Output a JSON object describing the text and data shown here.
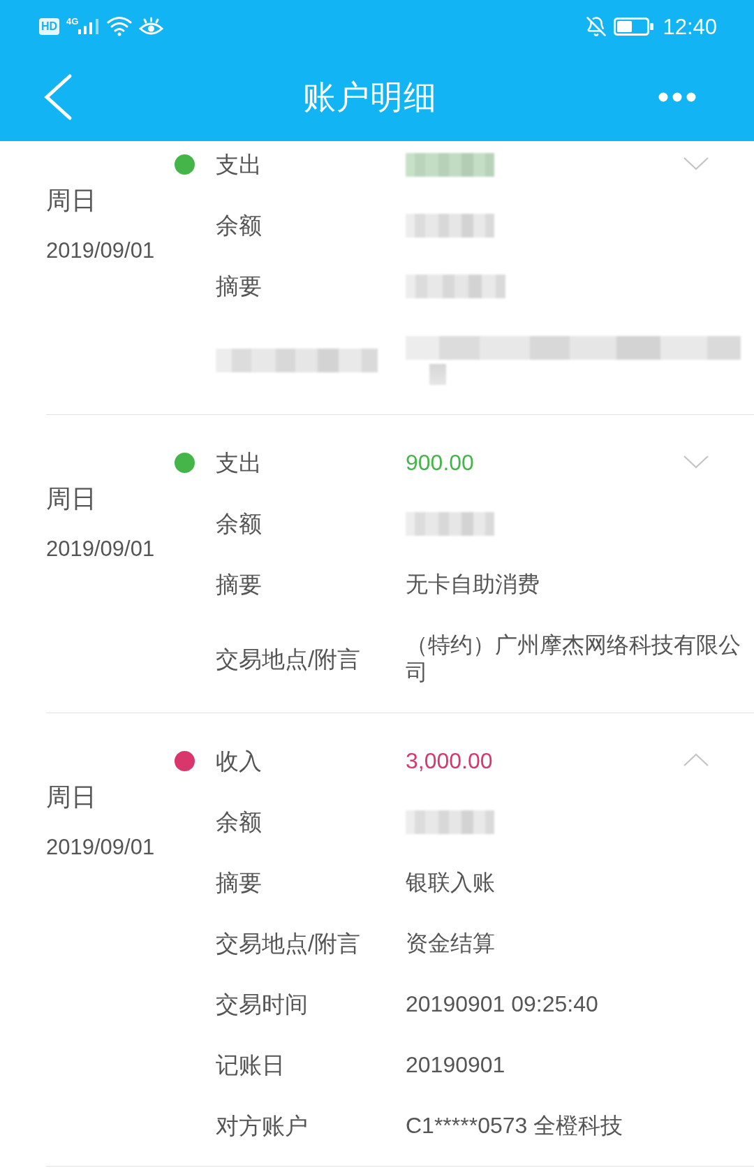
{
  "status_bar": {
    "hd_badge": "HD",
    "network": "4G",
    "time": "12:40"
  },
  "header": {
    "title": "账户明细"
  },
  "entries": [
    {
      "weekday": "周日",
      "date": "2019/09/01",
      "type": "支出",
      "color": "#45b549",
      "expanded": false,
      "amount_redacted": true,
      "fields": [
        {
          "label": "余额",
          "label_redacted": false,
          "value_redacted": true
        },
        {
          "label": "摘要",
          "label_redacted": false,
          "value_redacted": true
        },
        {
          "label_redacted": true,
          "value_redacted": true
        }
      ]
    },
    {
      "weekday": "周日",
      "date": "2019/09/01",
      "type": "支出",
      "color": "#45b549",
      "expanded": false,
      "amount": "900.00",
      "amount_redacted": false,
      "fields": [
        {
          "label": "余额",
          "label_redacted": false,
          "value_redacted": true
        },
        {
          "label": "摘要",
          "label_redacted": false,
          "value": "无卡自助消费",
          "value_redacted": false
        },
        {
          "label": "交易地点/附言",
          "label_redacted": false,
          "value": "（特约）广州摩杰网络科技有限公司",
          "value_redacted": false
        }
      ]
    },
    {
      "weekday": "周日",
      "date": "2019/09/01",
      "type": "收入",
      "color": "#d9376b",
      "expanded": true,
      "amount": "3,000.00",
      "amount_redacted": false,
      "fields": [
        {
          "label": "余额",
          "label_redacted": false,
          "value_redacted": true
        },
        {
          "label": "摘要",
          "label_redacted": false,
          "value": "银联入账",
          "value_redacted": false
        },
        {
          "label": "交易地点/附言",
          "label_redacted": false,
          "value": "资金结算",
          "value_redacted": false
        },
        {
          "label": "交易时间",
          "label_redacted": false,
          "value": "20190901 09:25:40",
          "value_redacted": false
        },
        {
          "label": "记账日",
          "label_redacted": false,
          "value": "20190901",
          "value_redacted": false
        },
        {
          "label": "对方账户",
          "label_redacted": false,
          "value": "C1*****0573 全橙科技",
          "value_redacted": false
        }
      ]
    }
  ]
}
